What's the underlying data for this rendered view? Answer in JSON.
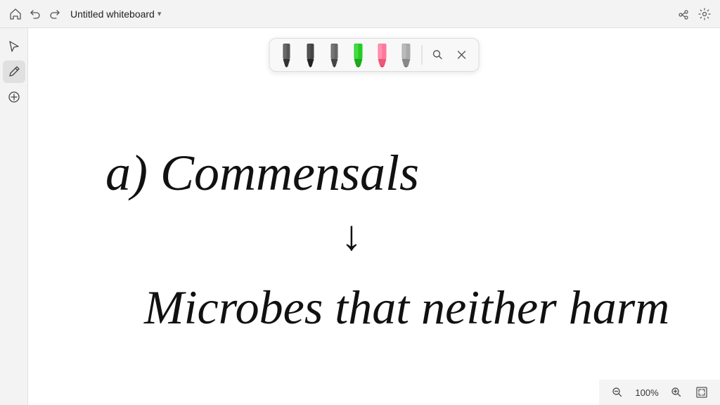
{
  "titlebar": {
    "title": "Untitled whiteboard",
    "zoom_level": "100%"
  },
  "tools": {
    "select_label": "Select",
    "pen_label": "Pen",
    "add_label": "Add"
  },
  "pen_toolbar": {
    "pens": [
      {
        "id": "pen-black1",
        "color": "black",
        "label": "Black pen 1"
      },
      {
        "id": "pen-black2",
        "color": "black",
        "label": "Black pen 2"
      },
      {
        "id": "pen-black3",
        "color": "dark-gray",
        "label": "Dark pen"
      },
      {
        "id": "pen-green",
        "color": "green",
        "label": "Green highlighter"
      },
      {
        "id": "pen-pink",
        "color": "pink",
        "label": "Pink highlighter"
      },
      {
        "id": "pen-gray",
        "color": "gray",
        "label": "Gray marker"
      }
    ],
    "search_label": "Search",
    "close_label": "Close"
  },
  "content": {
    "line1": "a) Commensals",
    "arrow": "↓",
    "line2": "Microbes that neither harm"
  },
  "footer": {
    "zoom_out_label": "Zoom out",
    "zoom_level": "100%",
    "zoom_in_label": "Zoom in",
    "fit_label": "Fit to screen"
  }
}
